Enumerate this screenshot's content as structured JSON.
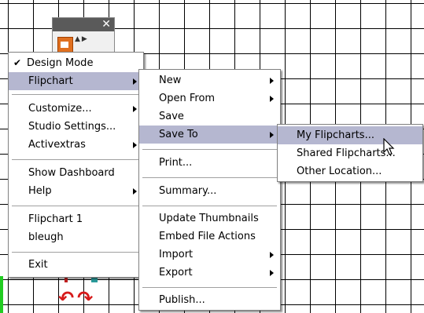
{
  "main_menu": {
    "items": [
      {
        "label": "Design Mode",
        "checked": true
      },
      {
        "label": "Flipchart"
      },
      {
        "label": "Customize..."
      },
      {
        "label": "Studio Settings..."
      },
      {
        "label": "Activextras"
      },
      {
        "label": "Show Dashboard"
      },
      {
        "label": "Help"
      },
      {
        "label": "Flipchart 1"
      },
      {
        "label": "bleugh"
      },
      {
        "label": "Exit"
      }
    ]
  },
  "flipchart_menu": {
    "items": [
      {
        "label": "New"
      },
      {
        "label": "Open From"
      },
      {
        "label": "Save"
      },
      {
        "label": "Save To"
      },
      {
        "label": "Print..."
      },
      {
        "label": "Summary..."
      },
      {
        "label": "Update Thumbnails"
      },
      {
        "label": "Embed File Actions"
      },
      {
        "label": "Import"
      },
      {
        "label": "Export"
      },
      {
        "label": "Publish..."
      }
    ]
  },
  "save_to_menu": {
    "items": [
      {
        "label": "My Flipcharts..."
      },
      {
        "label": "Shared Flipcharts..."
      },
      {
        "label": "Other Location..."
      }
    ]
  },
  "toolbox": {
    "close_glyph": "✕"
  },
  "icons": {
    "check": "✔",
    "undo": "↶",
    "redo": "↷"
  },
  "colors": {
    "highlight": "#b5b7d0",
    "toolbar_title": "#5a5a5a",
    "undo_redo": "#d61a1a",
    "green_edge": "#22cc22"
  }
}
